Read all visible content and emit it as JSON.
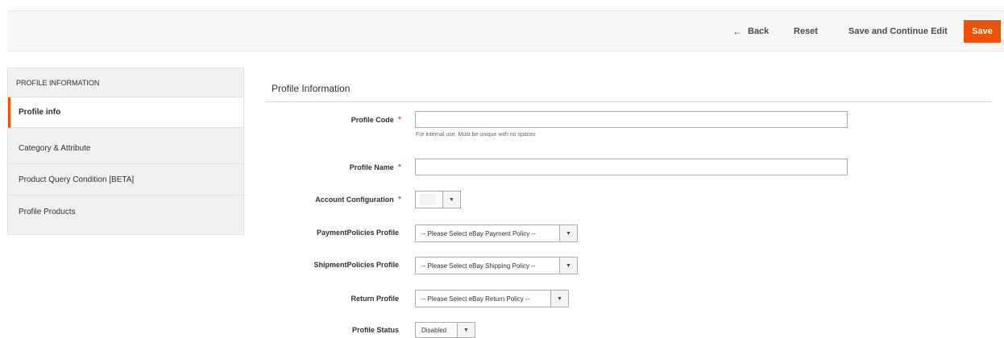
{
  "actions": {
    "back_label": "Back",
    "reset_label": "Reset",
    "save_continue_label": "Save and Continue Edit",
    "save_label": "Save",
    "accent": "#eb5202"
  },
  "tabs": {
    "title": "PROFILE INFORMATION",
    "items": [
      {
        "label": "Profile info",
        "active": true
      },
      {
        "label": "Category & Attribute",
        "active": false
      },
      {
        "label": "Product Query Condition [BETA]",
        "active": false
      },
      {
        "label": "Profile Products",
        "active": false
      }
    ]
  },
  "form": {
    "section_title": "Profile Information",
    "profile_code": {
      "label": "Profile Code",
      "required": true,
      "value": "",
      "note": "For internal use. Must be unique with no spaces"
    },
    "profile_name": {
      "label": "Profile Name",
      "required": true,
      "value": ""
    },
    "account_configuration": {
      "label": "Account Configuration",
      "required": true,
      "value": ""
    },
    "payment_policies": {
      "label": "PaymentPolicies Profile",
      "value": "-- Please Select eBay Payment Policy --"
    },
    "shipment_policies": {
      "label": "ShipmentPolicies Profile",
      "value": "-- Please Select eBay Shipping Policy --"
    },
    "return_profile": {
      "label": "Return Profile",
      "value": "-- Please Select eBay Return Policy --"
    },
    "profile_status": {
      "label": "Profile Status",
      "value": "Disabled"
    }
  },
  "icons": {
    "back": "arrow-left-icon",
    "dropdown": "triangle-down-icon"
  }
}
